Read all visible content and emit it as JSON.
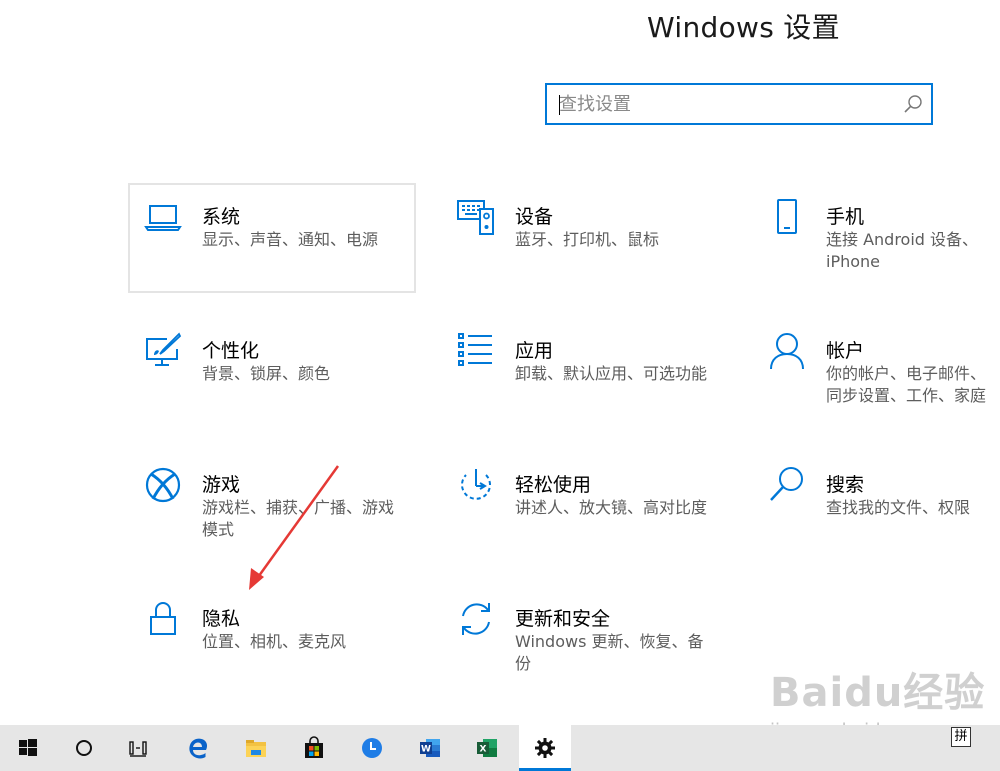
{
  "window": {
    "title": "Windows 设置"
  },
  "search": {
    "placeholder": "查找设置"
  },
  "tiles": [
    {
      "name": "系统",
      "desc": "显示、声音、通知、电源",
      "icon": "laptop-icon"
    },
    {
      "name": "设备",
      "desc": "蓝牙、打印机、鼠标",
      "icon": "keyboard-speaker-icon"
    },
    {
      "name": "手机",
      "desc": "连接 Android 设备、iPhone",
      "icon": "phone-icon"
    },
    {
      "name": "个性化",
      "desc": "背景、锁屏、颜色",
      "icon": "paint-monitor-icon"
    },
    {
      "name": "应用",
      "desc": "卸载、默认应用、可选功能",
      "icon": "app-list-icon"
    },
    {
      "name": "帐户",
      "desc": "你的帐户、电子邮件、同步设置、工作、家庭",
      "icon": "person-icon"
    },
    {
      "name": "游戏",
      "desc": "游戏栏、捕获、广播、游戏模式",
      "icon": "xbox-icon"
    },
    {
      "name": "轻松使用",
      "desc": "讲述人、放大镜、高对比度",
      "icon": "ease-of-access-icon"
    },
    {
      "name": "搜索",
      "desc": "查找我的文件、权限",
      "icon": "search-icon"
    },
    {
      "name": "隐私",
      "desc": "位置、相机、麦克风",
      "icon": "lock-icon"
    },
    {
      "name": "更新和安全",
      "desc": "Windows 更新、恢复、备份",
      "icon": "sync-icon"
    }
  ],
  "taskbar": {
    "items": [
      "start-icon",
      "cortana-icon",
      "task-view-icon",
      "edge-icon",
      "file-explorer-icon",
      "store-icon",
      "clock-app-icon",
      "word-icon",
      "excel-icon",
      "settings-icon"
    ],
    "active": "settings-icon",
    "ime": "拼"
  },
  "watermark": {
    "brand": "Baidu经验",
    "url": "jingyan.baidu.com"
  },
  "colors": {
    "accent": "#0078d7",
    "annotation_arrow": "#e53935"
  }
}
